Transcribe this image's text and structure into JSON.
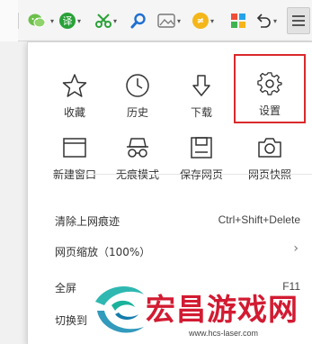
{
  "toolbar": {
    "translate_label": "译",
    "icons": [
      "wechat-icon",
      "translate-icon",
      "scissors-icon",
      "search-icon",
      "screenshot-icon",
      "clean-icon",
      "apps-grid-icon",
      "undo-icon",
      "hamburger-menu-icon"
    ]
  },
  "menu": {
    "grid": [
      {
        "label": "收藏",
        "icon": "star-icon"
      },
      {
        "label": "历史",
        "icon": "clock-icon"
      },
      {
        "label": "下载",
        "icon": "download-arrow-icon"
      },
      {
        "label": "设置",
        "icon": "gear-icon"
      },
      {
        "label": "新建窗口",
        "icon": "window-icon"
      },
      {
        "label": "无痕模式",
        "icon": "incognito-glasses-icon"
      },
      {
        "label": "保存网页",
        "icon": "save-disk-icon"
      },
      {
        "label": "网页快照",
        "icon": "camera-icon"
      }
    ],
    "items": [
      {
        "label": "清除上网痕迹",
        "shortcut": "Ctrl+Shift+Delete"
      },
      {
        "label": "网页缩放（100%）",
        "arrow": "›"
      },
      {
        "label": "全屏",
        "shortcut": "F11"
      },
      {
        "label": "切换到",
        "shortcut": ""
      }
    ]
  },
  "watermark": {
    "title": "宏昌游戏网",
    "url": "www.hcs-laser.com"
  },
  "colors": {
    "highlight_border": "#d9292c",
    "watermark_red": "#d21b32",
    "icon_green": "#2aa138"
  }
}
